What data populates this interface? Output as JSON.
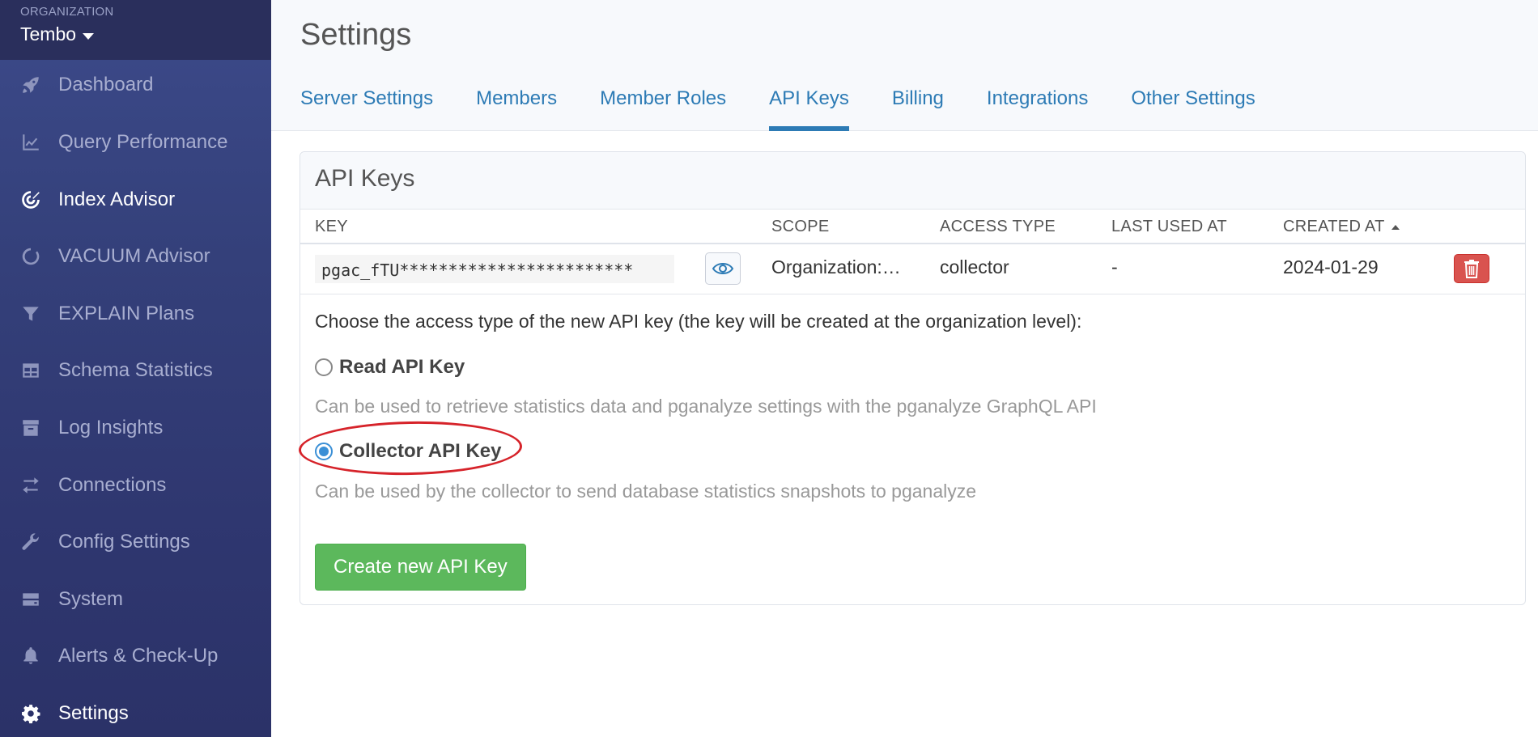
{
  "sidebar": {
    "org_label": "ORGANIZATION",
    "org_name": "Tembo",
    "items": [
      {
        "label": "Dashboard",
        "icon": "rocket-icon"
      },
      {
        "label": "Query Performance",
        "icon": "line-chart-icon"
      },
      {
        "label": "Index Advisor",
        "icon": "target-icon"
      },
      {
        "label": "VACUUM Advisor",
        "icon": "circle-notch-icon"
      },
      {
        "label": "EXPLAIN Plans",
        "icon": "filter-icon"
      },
      {
        "label": "Schema Statistics",
        "icon": "table-icon"
      },
      {
        "label": "Log Insights",
        "icon": "archive-icon"
      },
      {
        "label": "Connections",
        "icon": "exchange-icon"
      },
      {
        "label": "Config Settings",
        "icon": "wrench-icon"
      },
      {
        "label": "System",
        "icon": "hdd-icon"
      },
      {
        "label": "Alerts & Check-Up",
        "icon": "bell-icon"
      },
      {
        "label": "Settings",
        "icon": "gear-icon"
      }
    ],
    "active": "Settings"
  },
  "header": {
    "title": "Settings",
    "tabs": [
      {
        "label": "Server Settings"
      },
      {
        "label": "Members"
      },
      {
        "label": "Member Roles"
      },
      {
        "label": "API Keys"
      },
      {
        "label": "Billing"
      },
      {
        "label": "Integrations"
      },
      {
        "label": "Other Settings"
      }
    ],
    "active_tab": "API Keys"
  },
  "panel": {
    "title": "API Keys",
    "columns": {
      "key": "KEY",
      "scope": "SCOPE",
      "access_type": "ACCESS TYPE",
      "last_used_at": "LAST USED AT",
      "created_at": "CREATED AT"
    },
    "rows": [
      {
        "key": "pgac_fTU************************",
        "scope": "Organization:…",
        "access_type": "collector",
        "last_used_at": "-",
        "created_at": "2024-01-29"
      }
    ],
    "prompt": "Choose the access type of the new API key (the key will be created at the organization level):",
    "options": [
      {
        "label": "Read API Key",
        "help": "Can be used to retrieve statistics data and pganalyze settings with the pganalyze GraphQL API",
        "checked": false
      },
      {
        "label": "Collector API Key",
        "help": "Can be used by the collector to send database statistics snapshots to pganalyze",
        "checked": true
      }
    ],
    "create_button": "Create new API Key"
  },
  "colors": {
    "accent": "#2d7bb5",
    "success": "#5cb85c",
    "danger": "#d9534f",
    "annotation": "#d6232a"
  }
}
